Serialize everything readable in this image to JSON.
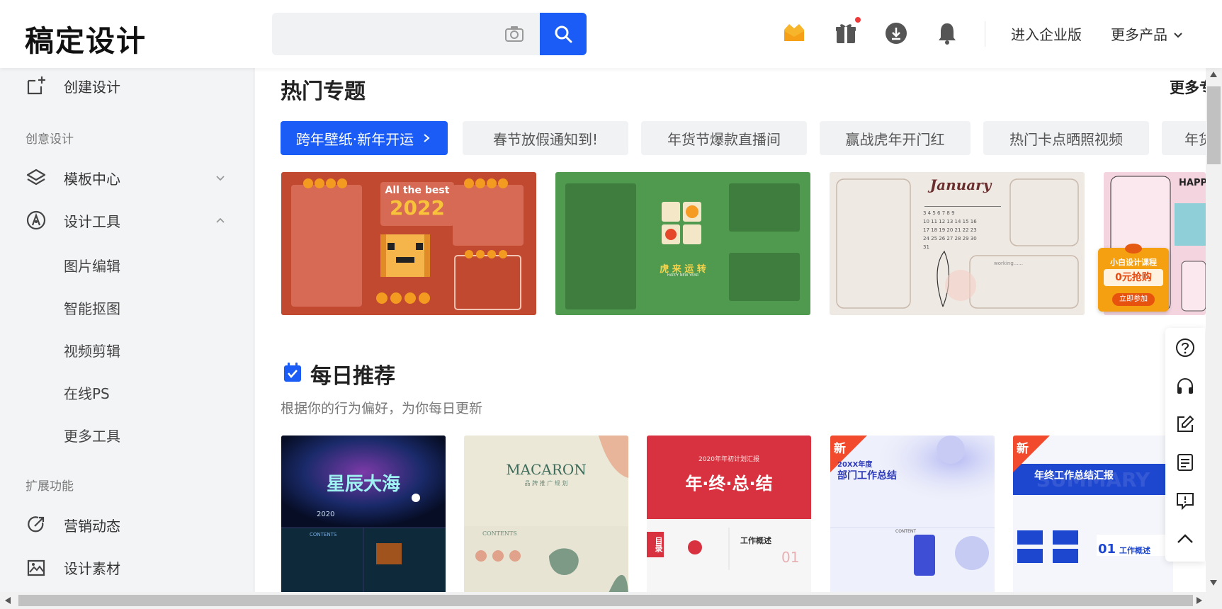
{
  "header": {
    "logo": "稿定设计",
    "search": {
      "placeholder": "",
      "value": ""
    },
    "links": {
      "enterprise": "进入企业版",
      "more_products": "更多产品"
    }
  },
  "sidebar": {
    "create": "创建设计",
    "section_creative": "创意设计",
    "template_center": "模板中心",
    "design_tools": "设计工具",
    "tools": [
      "图片编辑",
      "智能抠图",
      "视频剪辑",
      "在线PS",
      "更多工具"
    ],
    "section_extend": "扩展功能",
    "marketing": "营销动态",
    "materials": "设计素材"
  },
  "hot": {
    "title": "热门专题",
    "more": "更多专题",
    "tags": [
      "跨年壁纸·新年开运",
      "春节放假通知到!",
      "年货节爆款直播间",
      "赢战虎年开门红",
      "热门卡点晒照视频",
      "年货"
    ]
  },
  "thumbs": {
    "t1": {
      "top_text": "All the best",
      "year": "2022"
    },
    "t2": {
      "caption": "虎 来 运 转",
      "sub": "HAPPY NEW YEAR"
    },
    "t3": {
      "month": "January",
      "note": "working......"
    },
    "t4": {
      "title": "HAPPY",
      "promo_title": "小白设计课程",
      "promo_price": "0元抢购",
      "promo_btn": "立即参加"
    }
  },
  "daily": {
    "title": "每日推荐",
    "subtitle": "根据你的行为偏好，为你每日更新",
    "new_badge": "新",
    "cards": [
      {
        "title": "星辰大海",
        "sub": "2020",
        "contents": "CONTENTS"
      },
      {
        "title": "MACARON",
        "sub": "品 牌 推 广 规 划",
        "contents": "CONTENTS"
      },
      {
        "title": "年·终·总·结",
        "sub": "2020年年初计划汇报",
        "ribbon": "目录",
        "section": "工作概述",
        "num": "01"
      },
      {
        "title": "部门工作总结",
        "sub": "20XX年度",
        "contents": "CONTENT"
      },
      {
        "title": "年终工作总结汇报",
        "bg_word": "SUMMARY",
        "section": "工作概述",
        "num": "01"
      }
    ]
  },
  "colors": {
    "accent": "#1a5cf5",
    "badge": "#f24a2c"
  }
}
